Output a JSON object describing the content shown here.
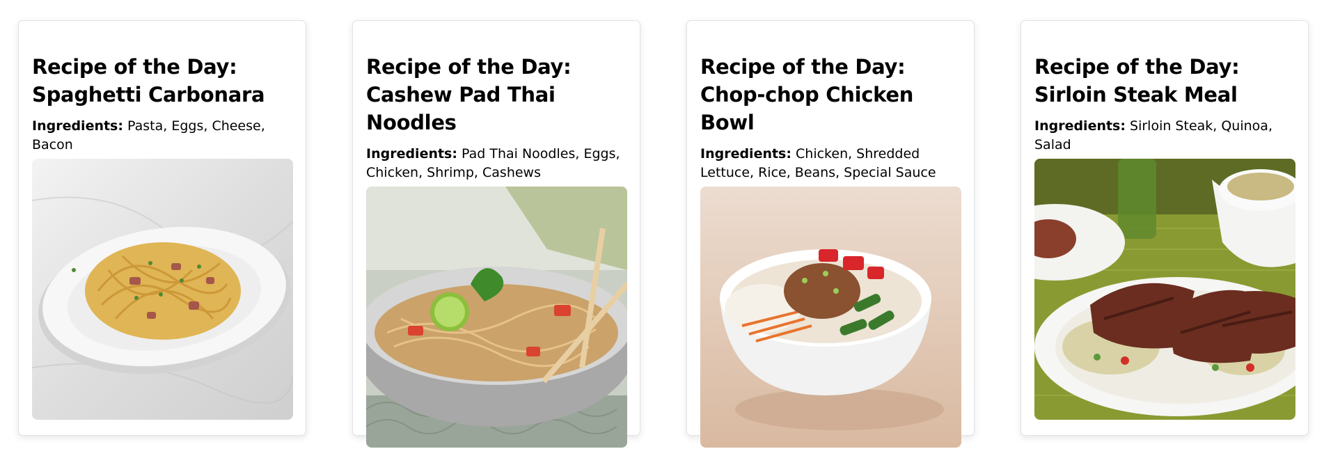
{
  "recipes": [
    {
      "title": "Recipe of the Day: Spaghetti Carbonara",
      "ingredients_label": "Ingredients:",
      "ingredients": "Pasta, Eggs, Cheese, Bacon",
      "photo": "spaghetti-carbonara-photo"
    },
    {
      "title": "Recipe of the Day: Cashew Pad Thai Noodles",
      "ingredients_label": "Ingredients:",
      "ingredients": "Pad Thai Noodles, Eggs, Chicken, Shrimp, Cashews",
      "photo": "pad-thai-photo"
    },
    {
      "title": "Recipe of the Day: Chop-chop Chicken Bowl",
      "ingredients_label": "Ingredients:",
      "ingredients": "Chicken, Shredded Lettuce, Rice, Beans, Special Sauce",
      "photo": "chicken-bowl-photo"
    },
    {
      "title": "Recipe of the Day: Sirloin Steak Meal",
      "ingredients_label": "Ingredients:",
      "ingredients": "Sirloin Steak, Quinoa, Salad",
      "photo": "sirloin-steak-photo"
    }
  ]
}
